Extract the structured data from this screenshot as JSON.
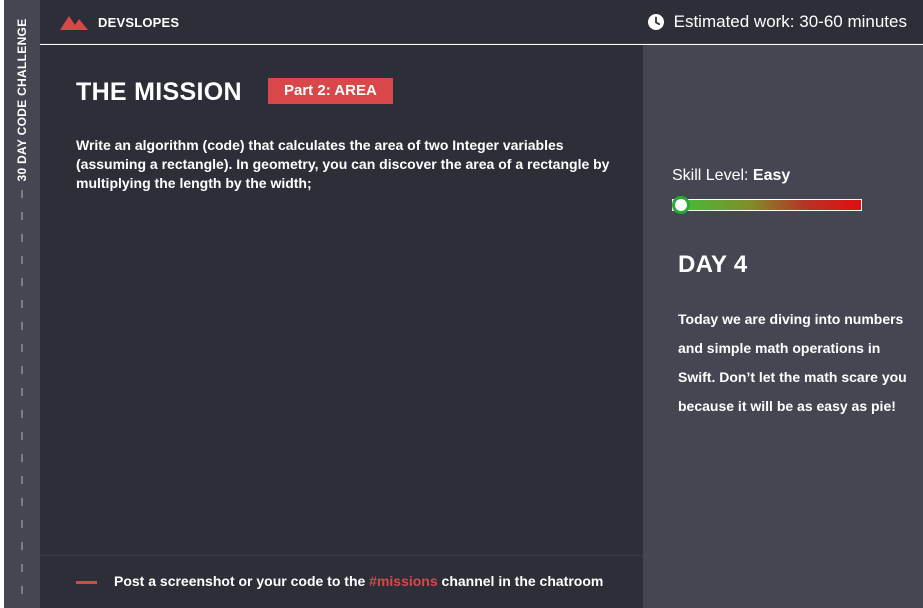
{
  "sidebar": {
    "title": "30 DAY CODE CHALLENGE"
  },
  "header": {
    "brand": "DEVSLOPES",
    "estimate_text": "Estimated work: 30-60 minutes",
    "icons": {
      "logo": "devslopes-logo-icon",
      "clock": "clock-icon"
    }
  },
  "mission": {
    "title": "THE MISSION",
    "part_label": "Part 2: AREA",
    "description": "Write an algorithm (code) that calculates the area of two Integer variables (assuming a rectangle). In geometry, you can discover the area of a rectangle by multiplying the length by the width;"
  },
  "footer": {
    "text_before": "Post a screenshot or your code to the ",
    "channel": "#missions",
    "text_after": " channel in the chatroom"
  },
  "aside": {
    "skill_label": "Skill Level: ",
    "skill_value": "Easy",
    "skill_fraction": 0.0,
    "day_title": "DAY 4",
    "day_description": "Today we are diving into numbers and simple math operations in Swift. Don’t let the math scare you because it will be as easy as pie!"
  },
  "colors": {
    "accent": "#d9474a",
    "panel_dark": "#2d2f38",
    "panel_light": "#444752",
    "skill_start": "#3fc13b",
    "skill_end": "#e30d10"
  }
}
